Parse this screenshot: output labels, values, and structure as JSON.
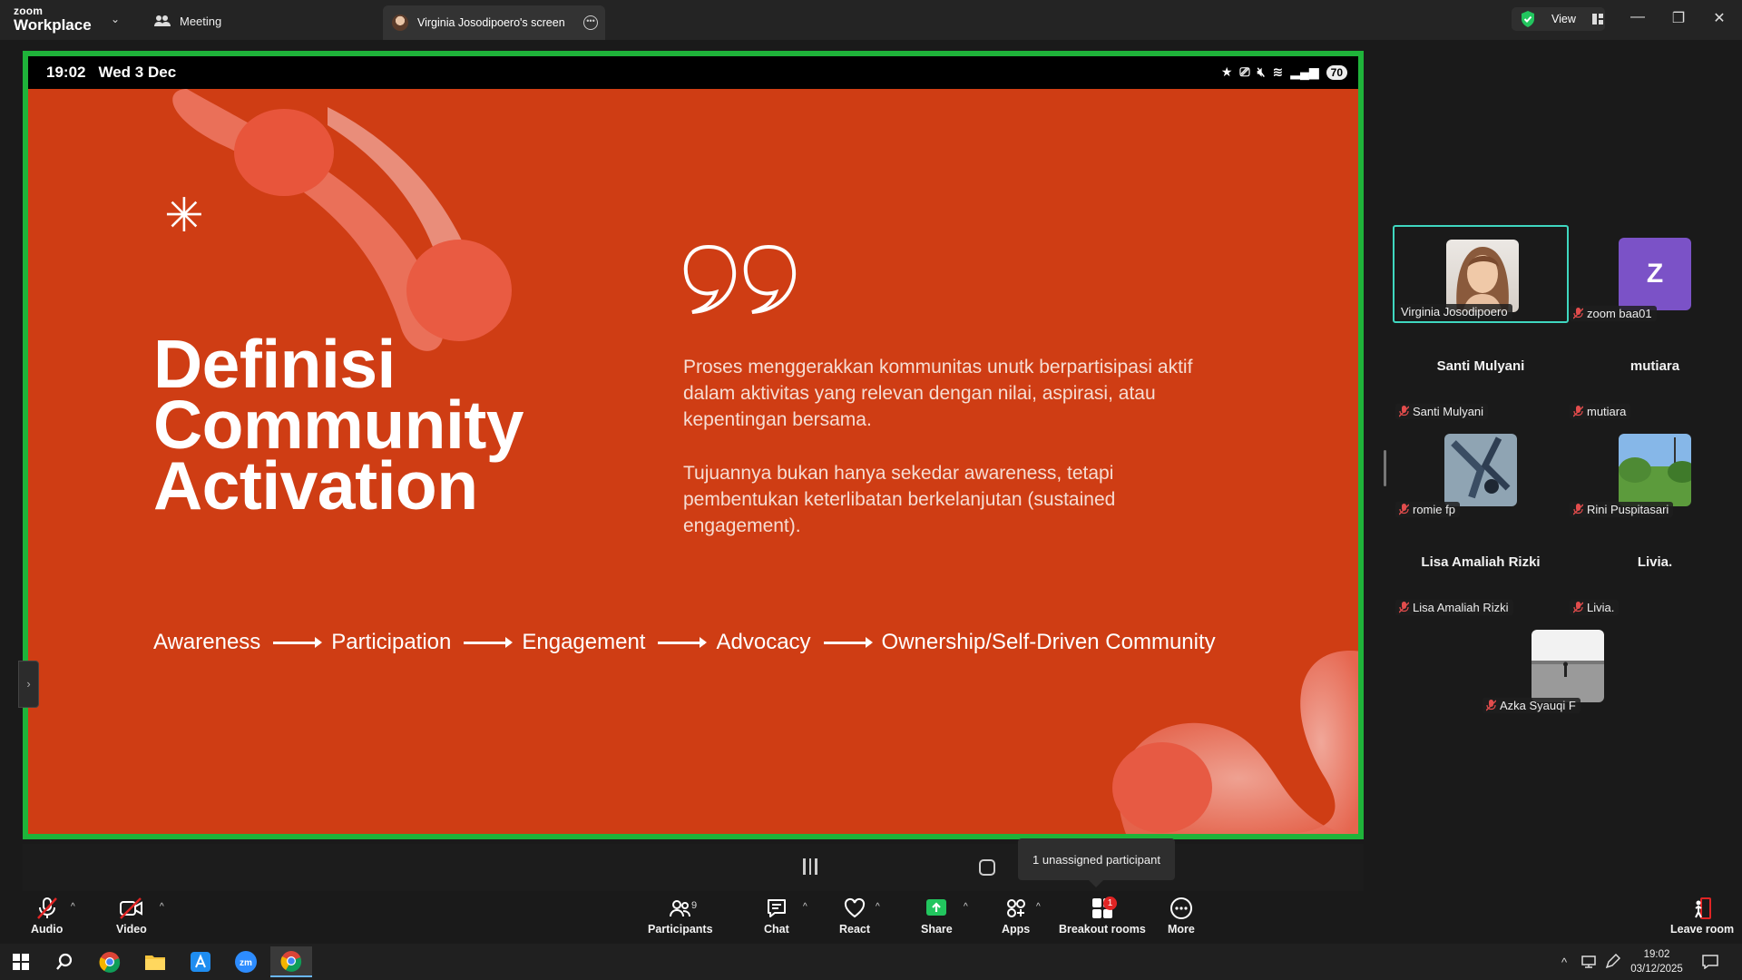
{
  "titlebar": {
    "logo_line1": "zoom",
    "logo_line2": "Workplace",
    "meeting_tab": "Meeting",
    "screen_tab": "Virginia Josodipoero's screen",
    "view_label": "View"
  },
  "shared_screen": {
    "time": "19:02",
    "date": "Wed 3 Dec",
    "battery": "70",
    "slide": {
      "title_lines": [
        "Definisi",
        "Community",
        "Activation"
      ],
      "paragraph1": "Proses menggerakkan kommunitas unutk berpartisipasi aktif dalam aktivitas yang relevan dengan nilai, aspirasi, atau kepentingan bersama.",
      "paragraph2": "Tujuannya bukan hanya sekedar awareness, tetapi pembentukan keterlibatan berkelanjutan (sustained engagement).",
      "flow": [
        "Awareness",
        "Participation",
        "Engagement",
        "Advocacy",
        "Ownership/Self-Driven Community"
      ]
    }
  },
  "tooltip": "1 unassigned participant",
  "participants": [
    {
      "name": "Virginia Josodipoero",
      "display": "photo",
      "active": true
    },
    {
      "name": "zoom baa01",
      "display": "initial",
      "initial": "Z"
    },
    {
      "name": "Santi Mulyani",
      "display": "name"
    },
    {
      "name": "mutiara",
      "display": "name"
    },
    {
      "name": "romie fp",
      "display": "photo"
    },
    {
      "name": "Rini Puspitasari",
      "display": "photo"
    },
    {
      "name": "Lisa Amaliah Rizki",
      "display": "name"
    },
    {
      "name": "Livia.",
      "display": "name"
    },
    {
      "name": "Azka Syauqi F",
      "display": "photo"
    }
  ],
  "toolbar": {
    "audio": "Audio",
    "video": "Video",
    "participants": "Participants",
    "participants_count": "9",
    "chat": "Chat",
    "react": "React",
    "share": "Share",
    "apps": "Apps",
    "breakout": "Breakout rooms",
    "breakout_badge": "1",
    "more": "More",
    "leave": "Leave room"
  },
  "taskbar": {
    "time": "19:02",
    "date": "03/12/2025"
  },
  "colors": {
    "slide_bg": "#cf3d14",
    "share_border": "#1fb33a",
    "share_green": "#22c55e",
    "active_tile": "#3fd7c0"
  }
}
